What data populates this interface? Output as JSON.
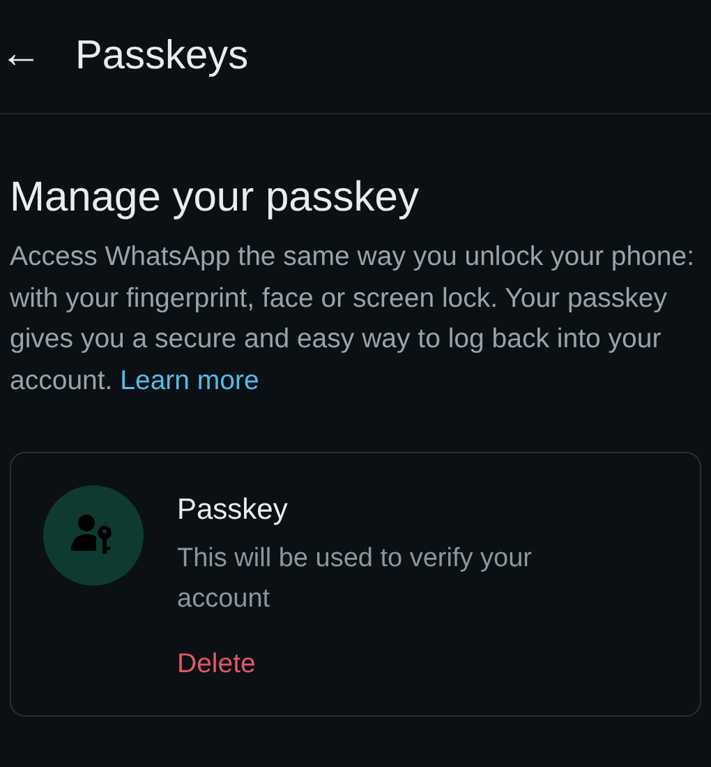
{
  "header": {
    "back_icon": "←",
    "title": "Passkeys"
  },
  "section": {
    "heading": "Manage your passkey",
    "description": "Access WhatsApp the same way you unlock your phone: with your fingerprint, face or screen lock. Your passkey gives you a secure and easy way to log back into your account.",
    "link": "Learn more"
  },
  "passkey_card": {
    "title": "Passkey",
    "subtitle": "This will be used to verify your account",
    "action": "Delete"
  }
}
